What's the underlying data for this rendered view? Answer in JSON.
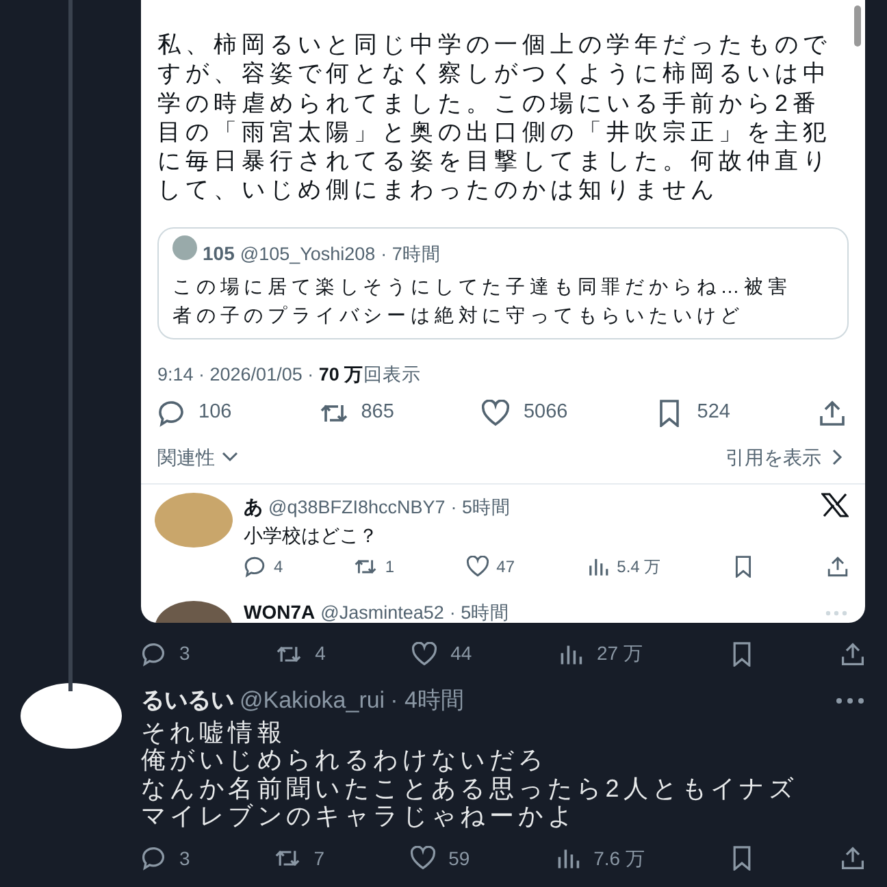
{
  "embedded_post": {
    "body": "私、柿岡るいと同じ中学の一個上の学年だったものですが、容姿で何となく察しがつくように柿岡るいは中学の時虐められてました。この場にいる手前から2番目の「雨宮太陽」と奥の出口側の「井吹宗正」を主犯に毎日暴行されてる姿を目撃してました。何故仲直りして、いじめ側にまわったのかは知りません",
    "quote": {
      "name": "105",
      "handle": "@105_Yoshi208",
      "time": "· 7時間",
      "text": "この場に居て楽しそうにしてた子達も同罪だからね…被害者の子のプライバシーは絶対に守ってもらいたいけど"
    },
    "meta": "9:14 · 2026/01/05 · **70 万**回表示",
    "actions": [
      {
        "kind": "reply",
        "count": "106"
      },
      {
        "kind": "repost",
        "count": "865"
      },
      {
        "kind": "like",
        "count": "5066"
      },
      {
        "kind": "bookmark",
        "count": "524"
      },
      {
        "kind": "share"
      }
    ],
    "sort": "関連性",
    "quotes_link": "引用を表示",
    "replies": [
      {
        "name": "あ",
        "handle": "@q38BFZI8hccNBY7",
        "time": "· 5時間",
        "text": "小学校はどこ？",
        "actions": [
          {
            "kind": "reply",
            "count": "4"
          },
          {
            "kind": "repost",
            "count": "1"
          },
          {
            "kind": "like",
            "count": "47"
          },
          {
            "kind": "views",
            "count": "5.4 万"
          },
          {
            "kind": "bookmark"
          },
          {
            "kind": "share"
          }
        ]
      },
      {
        "name": "WON7A",
        "handle": "@Jasmintea52",
        "time": "· 5時間"
      }
    ]
  },
  "thread_actions": [
    {
      "kind": "reply",
      "count": "3"
    },
    {
      "kind": "repost",
      "count": "4"
    },
    {
      "kind": "like",
      "count": "44"
    },
    {
      "kind": "views",
      "count": "27 万"
    },
    {
      "kind": "bookmark"
    },
    {
      "kind": "share"
    }
  ],
  "reply_post": {
    "name": "るいるい",
    "handle": "@Kakioka_rui",
    "time": "· 4時間",
    "lines": [
      "それ嘘情報",
      "俺がいじめられるわけないだろ",
      "なんか名前聞いたことある思ったら2人ともイナズマイレブンのキャラじゃねーかよ"
    ],
    "actions": [
      {
        "kind": "reply",
        "count": "3"
      },
      {
        "kind": "repost",
        "count": "7"
      },
      {
        "kind": "like",
        "count": "59"
      },
      {
        "kind": "views",
        "count": "7.6 万"
      },
      {
        "kind": "bookmark"
      },
      {
        "kind": "share"
      }
    ]
  }
}
